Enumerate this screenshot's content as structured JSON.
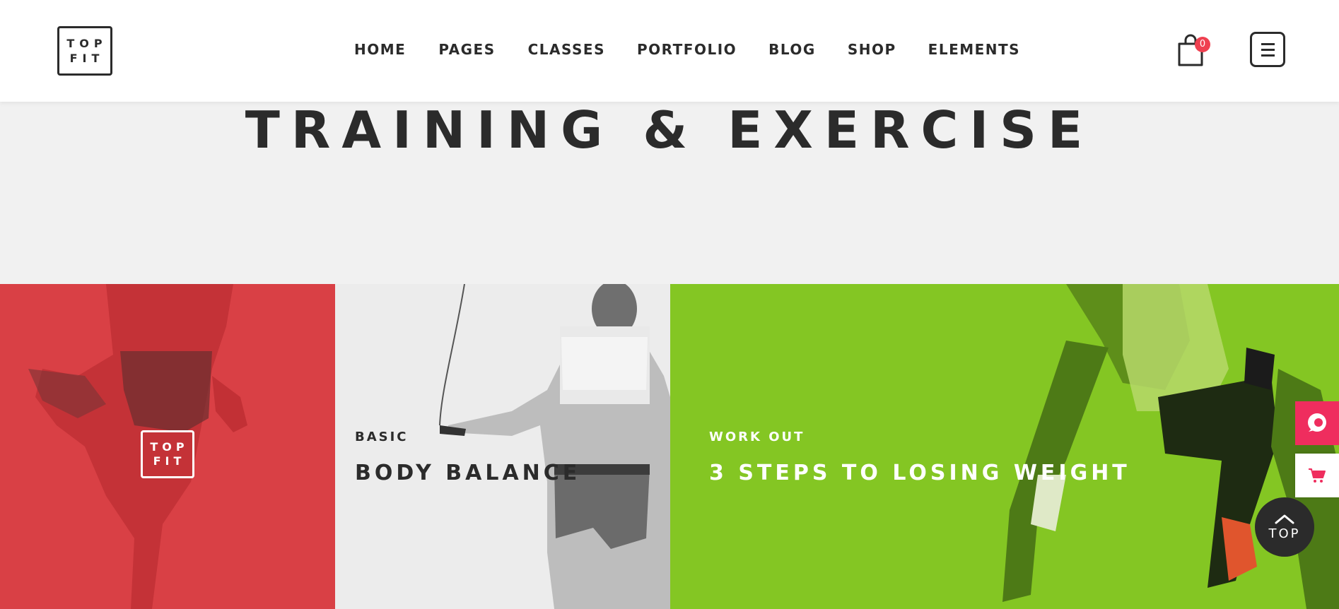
{
  "header": {
    "logo_line1": "TOP",
    "logo_line2": "FIT",
    "nav": [
      "HOME",
      "PAGES",
      "CLASSES",
      "PORTFOLIO",
      "BLOG",
      "SHOP",
      "ELEMENTS"
    ],
    "cart_count": "0"
  },
  "hero": {
    "title": "TRAINING & EXERCISE"
  },
  "panels": {
    "red": {
      "logo_line1": "TOP",
      "logo_line2": "FIT"
    },
    "gray": {
      "eyebrow": "BASIC",
      "title": "BODY BALANCE"
    },
    "green": {
      "eyebrow": "WORK OUT",
      "title": "3 STEPS TO LOSING WEIGHT"
    }
  },
  "widgets": {
    "top_label": "TOP"
  },
  "colors": {
    "red_panel": "#d94045",
    "green_panel": "#84c623",
    "accent_pink": "#ef2d5e",
    "dark": "#2b2b2b"
  },
  "icons": [
    "cart-icon",
    "hamburger-icon",
    "chat-bubble-icon",
    "shopping-cart-icon",
    "chevron-up-icon"
  ]
}
